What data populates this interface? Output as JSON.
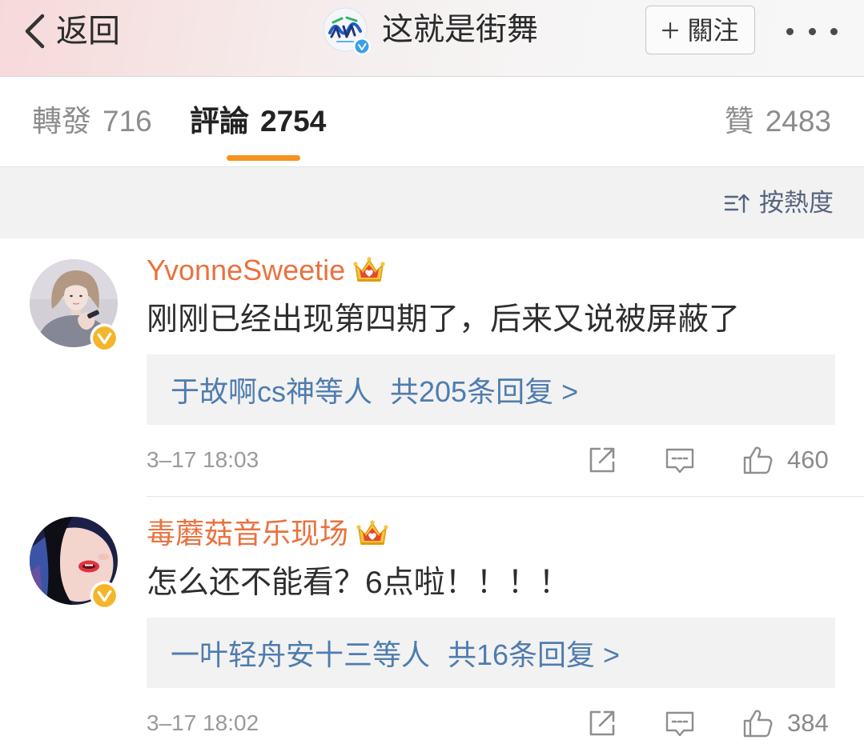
{
  "header": {
    "back_icon": "chevron-left-icon",
    "back_label": "返回",
    "account_logo": "account-logo-icon",
    "verified_icon": "verified-blue-icon",
    "account_name": "这就是街舞",
    "follow_icon": "plus-icon",
    "follow_label": "關注",
    "more_icon": "more-dots-icon"
  },
  "tabs": [
    {
      "label": "轉發",
      "count": "716",
      "active": false
    },
    {
      "label": "評論",
      "count": "2754",
      "active": true
    },
    {
      "label": "贊",
      "count": "2483",
      "active": false
    }
  ],
  "sort": {
    "icon": "sort-icon",
    "label": "按熱度"
  },
  "comments": [
    {
      "username": "YvonneSweetie",
      "member_badge": "crown-icon",
      "verified_badge": "verified-gold-icon",
      "text": "刚刚已经出现第四期了，后来又说被屏蔽了",
      "replies": {
        "users": "于故啊cs神等人",
        "summary": "共205条回复 >"
      },
      "time": "3–17 18:03",
      "likes": "460"
    },
    {
      "username": "毒蘑菇音乐现场",
      "member_badge": "crown-icon",
      "verified_badge": "verified-gold-icon",
      "text": "怎么还不能看？6点啦！！！！",
      "replies": {
        "users": "一叶轻舟安十三等人",
        "summary": "共16条回复 >"
      },
      "time": "3–17 18:02",
      "likes": "384"
    }
  ],
  "actions": {
    "share_icon": "share-icon",
    "comment_icon": "comment-icon",
    "like_icon": "thumbs-up-icon"
  },
  "colors": {
    "accent_orange": "#f7931e",
    "username": "#e9723f",
    "reply_link": "#4f7cae",
    "sort_text": "#56647f",
    "muted": "#9a9a9a",
    "panel_bg": "#f2f2f2",
    "verified_gold": "#f5b52a",
    "verified_blue": "#3aa0ea"
  }
}
